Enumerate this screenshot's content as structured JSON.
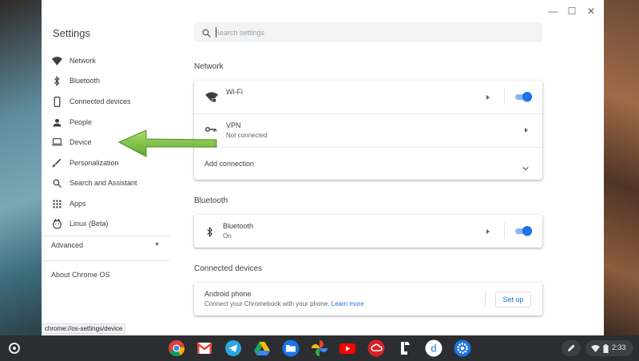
{
  "window": {
    "controls": {
      "minimize": "—",
      "maximize": "☐",
      "close": "✕"
    }
  },
  "sidebar": {
    "title": "Settings",
    "items": [
      {
        "label": "Network",
        "icon": "wifi-icon"
      },
      {
        "label": "Bluetooth",
        "icon": "bluetooth-icon"
      },
      {
        "label": "Connected devices",
        "icon": "phone-icon"
      },
      {
        "label": "People",
        "icon": "person-icon"
      },
      {
        "label": "Device",
        "icon": "laptop-icon"
      },
      {
        "label": "Personalization",
        "icon": "brush-icon"
      },
      {
        "label": "Search and Assistant",
        "icon": "search-icon"
      },
      {
        "label": "Apps",
        "icon": "apps-grid-icon"
      },
      {
        "label": "Linux (Beta)",
        "icon": "linux-icon"
      }
    ],
    "advanced": "Advanced",
    "about": "About Chrome OS"
  },
  "search": {
    "placeholder": "Search settings"
  },
  "sections": {
    "network": {
      "title": "Network",
      "wifi": {
        "label": "Wi-Fi",
        "enabled": true
      },
      "vpn": {
        "label": "VPN",
        "status": "Not connected"
      },
      "add_connection": "Add connection"
    },
    "bluetooth": {
      "title": "Bluetooth",
      "item": {
        "label": "Bluetooth",
        "status": "On",
        "enabled": true
      }
    },
    "connected_devices": {
      "title": "Connected devices",
      "android": {
        "label": "Android phone",
        "description": "Connect your Chromebook with your phone.",
        "link": "Learn more",
        "button": "Set up"
      }
    }
  },
  "tooltip": "chrome://os-settings/device",
  "shelf": {
    "apps": [
      "chrome-icon",
      "gmail-icon",
      "telegram-icon",
      "google-drive-icon",
      "files-icon",
      "google-photos-icon",
      "youtube-icon",
      "adobe-creative-cloud-icon",
      "app-icon",
      "dictionary-icon",
      "settings-icon"
    ],
    "time": "2:33"
  },
  "colors": {
    "accent": "#1a73e8",
    "arrow": "#7cc242"
  }
}
